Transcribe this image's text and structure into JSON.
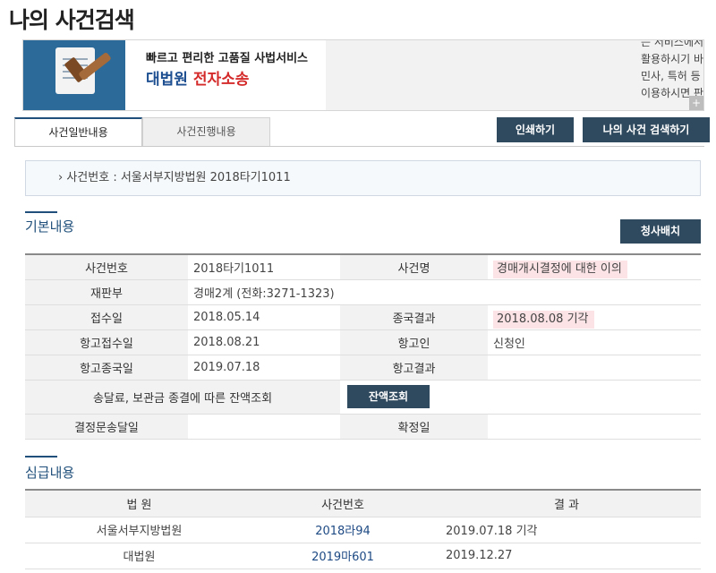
{
  "page": {
    "title": "나의 사건검색"
  },
  "banner": {
    "slogan": "빠르고 편리한 고품질 사법서비스",
    "brand_primary": "대법원",
    "brand_secondary": "전자소송",
    "lines": [
      "는 서비스에서 제공된 사건정보는 법적인 효력이 없으니, 참고자료로만",
      "활용하시기 바랍니다.",
      "민사, 특허 등 전자소송으로 진행되는 사건에 대해서는 전자소송 홈페이지를",
      "이용하시면 판결문이나 사건기록을 모두 인터넷으로 보실 수 있습니다."
    ],
    "plus": "+"
  },
  "tabs": [
    {
      "label": "사건일반내용"
    },
    {
      "label": "사건진행내용"
    }
  ],
  "actions": {
    "print": "인쇄하기",
    "my_case_search": "나의 사건 검색하기",
    "office_layout": "청사배치",
    "balance_check": "잔액조회"
  },
  "case_box": {
    "text": "사건번호 : 서울서부지방법원 2018타기1011"
  },
  "basic": {
    "title": "기본내용",
    "labels": {
      "case_no": "사건번호",
      "case_name": "사건명",
      "division": "재판부",
      "received": "접수일",
      "final_result": "종국결과",
      "appeal_received": "항고접수일",
      "appellant": "항고인",
      "appeal_final": "항고종국일",
      "appeal_result": "항고결과",
      "fee_balance": "송달료, 보관금 종결에 따른 잔액조회",
      "decision_served": "결정문송달일",
      "confirmed": "확정일"
    },
    "values": {
      "case_no": "2018타기1011",
      "case_name": "경매개시결정에 대한 이의",
      "division": "경매2계 (전화:3271-1323)",
      "received": "2018.05.14",
      "final_result": "2018.08.08 기각",
      "appeal_received": "2018.08.21",
      "appellant": "신청인",
      "appeal_final": "2019.07.18",
      "appeal_result": "",
      "decision_served": "",
      "confirmed": ""
    }
  },
  "trial": {
    "title": "심급내용",
    "headers": {
      "court": "법 원",
      "case_no": "사건번호",
      "result": "결 과"
    },
    "rows": [
      {
        "court": "서울서부지방법원",
        "case_no": "2018라94",
        "result": "2019.07.18 기각"
      },
      {
        "court": "대법원",
        "case_no": "2019마601",
        "result": "2019.12.27"
      }
    ]
  }
}
